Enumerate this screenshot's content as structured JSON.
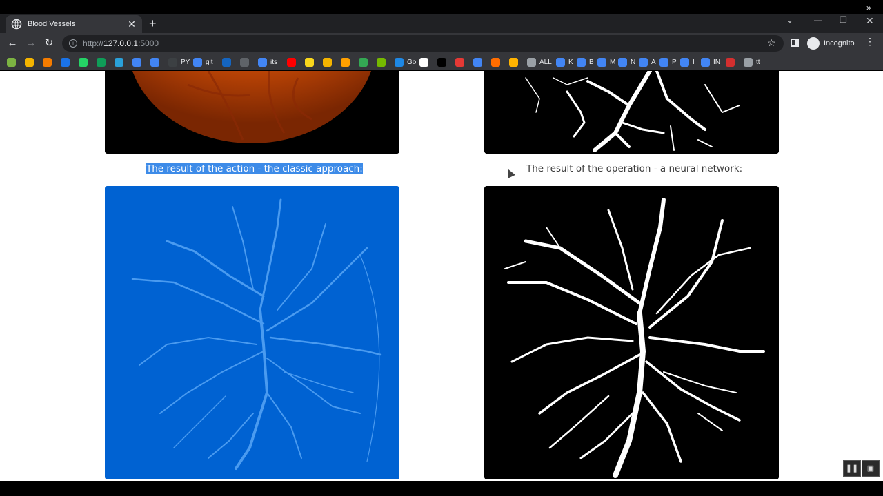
{
  "browser": {
    "tab_title": "Blood Vessels",
    "url_prefix": "http://",
    "url_host": "127.0.0.1",
    "url_port": ":5000",
    "profile_label": "Incognito",
    "bookmarks": [
      {
        "label": "",
        "color": "#7cb342"
      },
      {
        "label": "",
        "color": "#f4b400"
      },
      {
        "label": "",
        "color": "#f57c00"
      },
      {
        "label": "",
        "color": "#1a73e8"
      },
      {
        "label": "",
        "color": "#25d366"
      },
      {
        "label": "",
        "color": "#0f9d58"
      },
      {
        "label": "",
        "color": "#2aa1da"
      },
      {
        "label": "",
        "color": "#4285f4"
      },
      {
        "label": "",
        "color": "#4285f4"
      },
      {
        "label": "PY",
        "color": "#3c4043"
      },
      {
        "label": "git",
        "color": "#4285f4"
      },
      {
        "label": "",
        "color": "#1565c0"
      },
      {
        "label": "",
        "color": "#5f6368"
      },
      {
        "label": "its",
        "color": "#4285f4"
      },
      {
        "label": "",
        "color": "#ff0000"
      },
      {
        "label": "",
        "color": "#f9d71c"
      },
      {
        "label": "",
        "color": "#f4b400"
      },
      {
        "label": "",
        "color": "#ffa000"
      },
      {
        "label": "",
        "color": "#34a853"
      },
      {
        "label": "",
        "color": "#76b900"
      },
      {
        "label": "Go",
        "color": "#1e88e5"
      },
      {
        "label": "",
        "color": "#ffffff"
      },
      {
        "label": "",
        "color": "#000000"
      },
      {
        "label": "",
        "color": "#e53935"
      },
      {
        "label": "",
        "color": "#4285f4"
      },
      {
        "label": "",
        "color": "#ff6d00"
      },
      {
        "label": "",
        "color": "#ffb300"
      },
      {
        "label": "ALL",
        "color": "#9aa0a6"
      },
      {
        "label": "K",
        "color": "#4285f4"
      },
      {
        "label": "B",
        "color": "#4285f4"
      },
      {
        "label": "M",
        "color": "#4285f4"
      },
      {
        "label": "N",
        "color": "#4285f4"
      },
      {
        "label": "A",
        "color": "#4285f4"
      },
      {
        "label": "P",
        "color": "#4285f4"
      },
      {
        "label": "I",
        "color": "#4285f4"
      },
      {
        "label": "IN",
        "color": "#4285f4"
      },
      {
        "label": "",
        "color": "#d32f2f"
      },
      {
        "label": "tt",
        "color": "#9aa0a6"
      }
    ]
  },
  "page": {
    "caption_classic": "The result of the action - the classic approach:",
    "caption_neural": "The result of the operation - a neural network:"
  },
  "colors": {
    "classic_bg": "#0062d2",
    "classic_vessels": "#4a9bf0",
    "selection": "#3d8be8"
  }
}
